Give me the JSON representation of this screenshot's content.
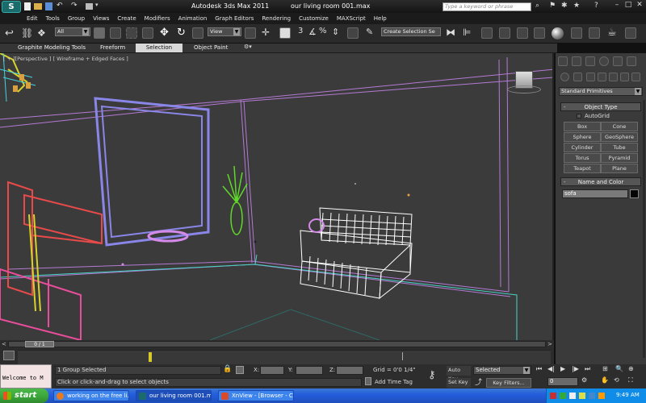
{
  "app": {
    "title": "Autodesk 3ds Max  2011",
    "filename": "our living room 001.max",
    "search_placeholder": "Type a keyword or phrase"
  },
  "menu": [
    "Edit",
    "Tools",
    "Group",
    "Views",
    "Create",
    "Modifiers",
    "Animation",
    "Graph Editors",
    "Rendering",
    "Customize",
    "MAXScript",
    "Help"
  ],
  "toolbar": {
    "selection_filter": "All",
    "reference_coord": "View",
    "named_selection": "Create Selection Se",
    "snap_label": "3",
    "percent_label": "%"
  },
  "ribbon": {
    "tabs": [
      "Graphite Modeling Tools",
      "Freeform",
      "Selection",
      "Object Paint"
    ],
    "active_tab": "Selection"
  },
  "viewport": {
    "label": "[ + ][Perspective ] [ Wireframe + Edged Faces ]"
  },
  "command_panel": {
    "dropdown": "Standard Primitives",
    "object_type_header": "Object Type",
    "autogrid_label": "AutoGrid",
    "primitives": [
      "Box",
      "Cone",
      "Sphere",
      "GeoSphere",
      "Cylinder",
      "Tube",
      "Torus",
      "Pyramid",
      "Teapot",
      "Plane"
    ],
    "name_color_header": "Name and Color",
    "object_name": "sofa",
    "object_color": "#050505"
  },
  "timeline": {
    "frame_display": "0 / 1"
  },
  "status": {
    "script_label": "Welcome to M",
    "selection_info": "1 Group Selected",
    "prompt": "Click or click-and-drag to select objects",
    "x_label": "X:",
    "y_label": "Y:",
    "z_label": "Z:",
    "grid": "Grid = 0'0 1/4\"",
    "add_time_tag": "Add Time Tag",
    "auto_key": "Auto Key",
    "set_key": "Set Key",
    "key_mode": "Selected",
    "key_filters": "Key Filters...",
    "frame": "0"
  },
  "taskbar": {
    "start": "start",
    "tasks": [
      "working on the free li...",
      "our living room 001.m...",
      "XnView - [Browser - C..."
    ],
    "clock": "9:49 AM"
  },
  "colors": {
    "viewport_bg": "#3b3b3b",
    "wire_white": "#ffffff",
    "wire_purple": "#b06ad9",
    "wire_pink": "#e94d9b",
    "wire_red": "#e84a4a",
    "wire_yellow": "#d8d22a",
    "wire_green": "#60d82a",
    "wire_blue": "#8a86e8",
    "taskbar_blue": "#245edb",
    "start_green": "#3ca83b"
  }
}
